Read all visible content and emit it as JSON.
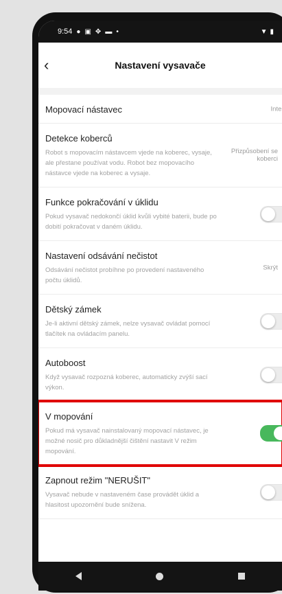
{
  "status_bar": {
    "time": "9:54",
    "left_icons": [
      "dot-icon",
      "image-icon",
      "network-icon",
      "message-icon",
      "dot-icon"
    ],
    "right_icons": [
      "wifi-icon",
      "battery-icon"
    ]
  },
  "header": {
    "title": "Nastavení vysavače",
    "back_icon": "chevron-left-icon"
  },
  "items": [
    {
      "title": "Mopovací nástavec",
      "value": "Inteligentní"
    },
    {
      "title": "Detekce koberců",
      "desc": "Robot s mopovacím nástavcem vjede na koberec, vysaje, ale přestane používat vodu. Robot bez mopovacího nástavce vjede na koberec a vysaje.",
      "value": "Přizpůsobení se koberci"
    },
    {
      "title": "Funkce pokračování v úklidu",
      "desc": "Pokud vysavač nedokončí úklid kvůli vybité baterii, bude po dobití pokračovat v daném úklidu.",
      "toggle": false
    },
    {
      "title": "Nastavení odsávání nečistot",
      "desc": "Odsávání nečistot probíhne po provedení nastaveného počtu úklidů.",
      "value": "Skrýt"
    },
    {
      "title": "Dětský zámek",
      "desc": "Je-li aktivní dětský zámek, nelze vysavač ovládat pomocí tlačítek na ovládacím panelu.",
      "toggle": false
    },
    {
      "title": "Autoboost",
      "desc": "Když vysavač rozpozná koberec, automaticky zvýší sací výkon.",
      "toggle": false
    },
    {
      "title": "V mopování",
      "desc": "Pokud má vysavač nainstalovaný mopovací nástavec, je možné nosič pro důkladnější čištění nastavit V režim mopování.",
      "toggle": true
    },
    {
      "title": "Zapnout režim \"NERUŠIT\"",
      "desc": "Vysavač nebude v nastaveném čase provádět úklid a hlasitost upozornění bude snížena.",
      "toggle": false
    }
  ],
  "colors": {
    "highlight": "#e00000",
    "toggle_on": "#48b85c"
  }
}
